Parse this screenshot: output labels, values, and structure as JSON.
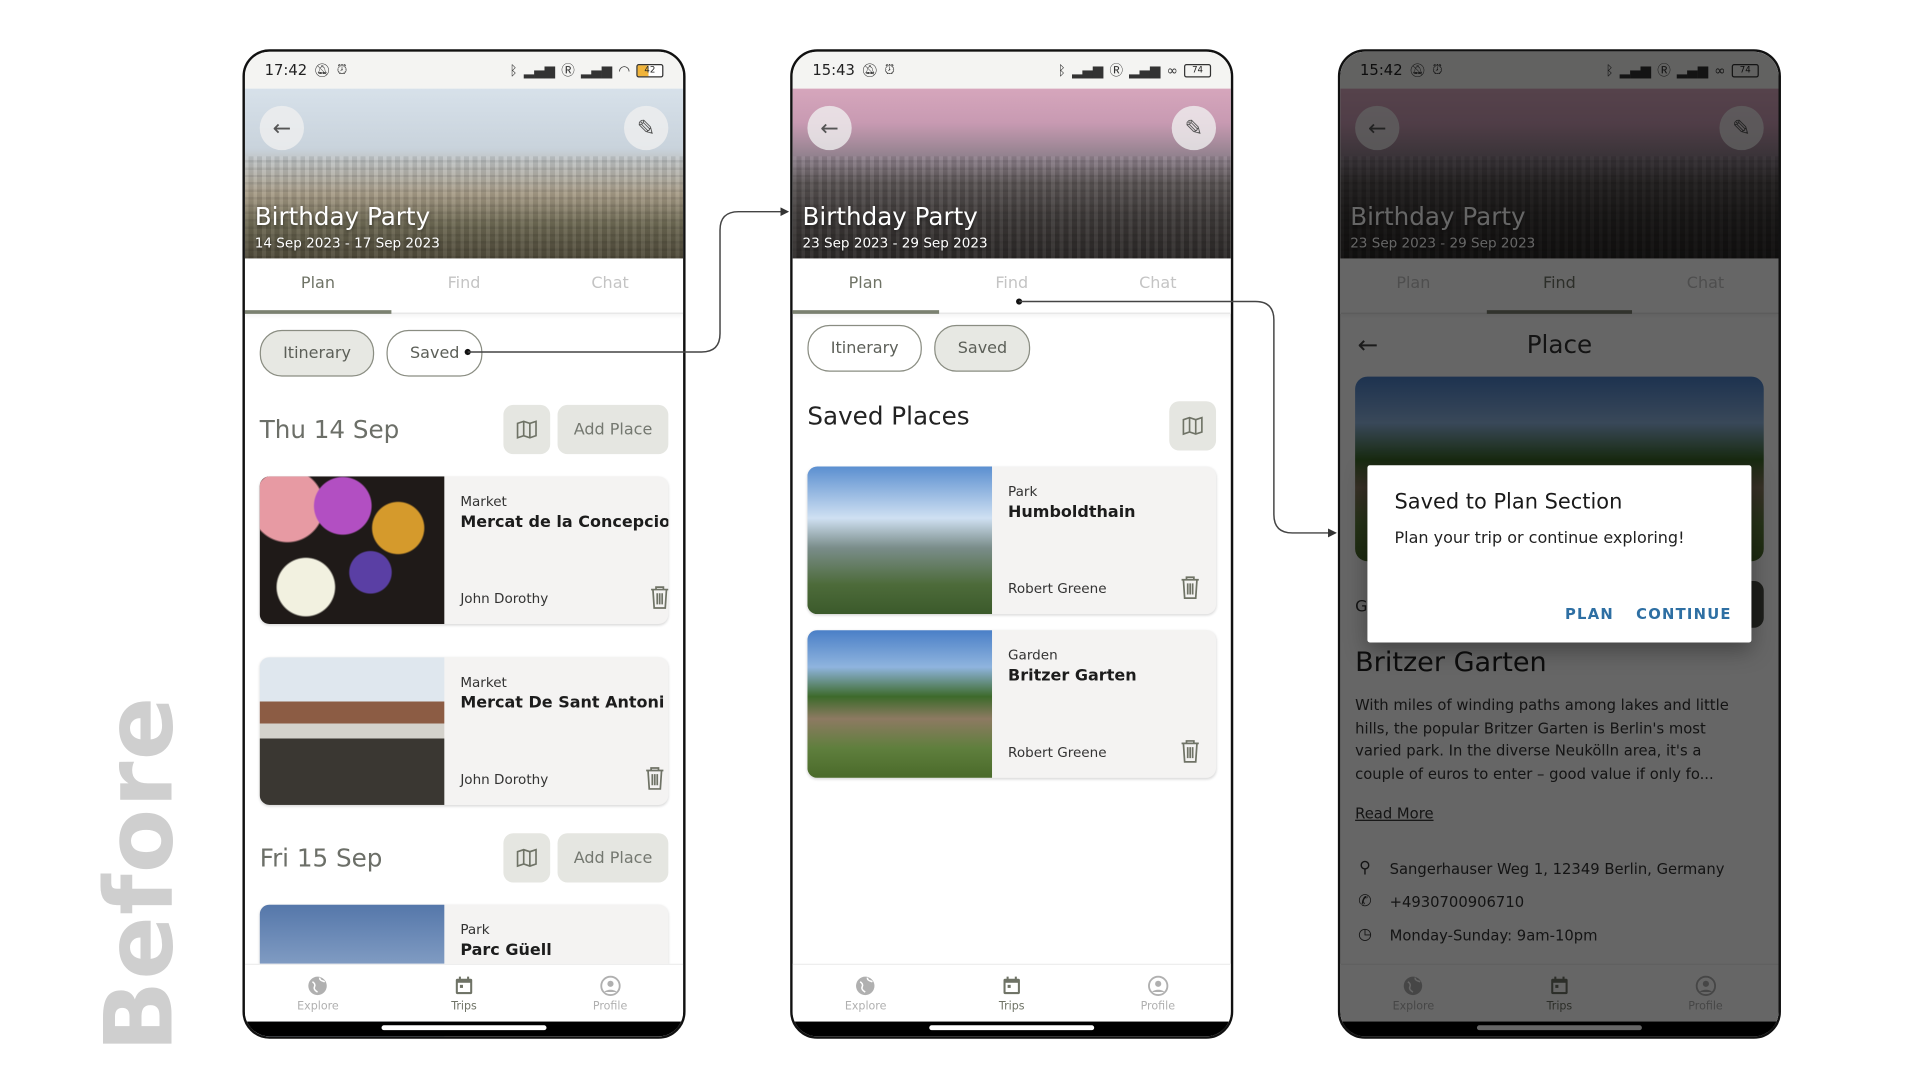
{
  "label": "Before",
  "screens": [
    {
      "status": {
        "time": "17:42",
        "battery": "42"
      },
      "hero": {
        "title": "Birthday Party",
        "dates": "14 Sep 2023 - 17 Sep 2023"
      },
      "tabs": [
        "Plan",
        "Find",
        "Chat"
      ],
      "active_tab": "Plan",
      "chips": [
        "Itinerary",
        "Saved"
      ],
      "active_chip": "Itinerary",
      "days": [
        {
          "title": "Thu 14 Sep",
          "add_label": "Add Place",
          "places": [
            {
              "category": "Market",
              "name": "Mercat de la Concepcio",
              "owner": "John Dorothy"
            },
            {
              "category": "Market",
              "name": "Mercat De Sant Antoni",
              "owner": "John Dorothy"
            }
          ]
        },
        {
          "title": "Fri 15 Sep",
          "add_label": "Add Place",
          "places": [
            {
              "category": "Park",
              "name": "Parc Güell",
              "owner": ""
            }
          ]
        }
      ],
      "nav": [
        "Explore",
        "Trips",
        "Profile"
      ],
      "active_nav": "Trips"
    },
    {
      "status": {
        "time": "15:43",
        "battery": "74"
      },
      "hero": {
        "title": "Birthday Party",
        "dates": "23 Sep 2023 - 29 Sep 2023"
      },
      "tabs": [
        "Plan",
        "Find",
        "Chat"
      ],
      "active_tab": "Plan",
      "chips": [
        "Itinerary",
        "Saved"
      ],
      "active_chip": "Saved",
      "section_title": "Saved Places",
      "places": [
        {
          "category": "Park",
          "name": "Humboldthain",
          "owner": "Robert Greene"
        },
        {
          "category": "Garden",
          "name": "Britzer Garten",
          "owner": "Robert Greene"
        }
      ],
      "nav": [
        "Explore",
        "Trips",
        "Profile"
      ],
      "active_nav": "Trips"
    },
    {
      "status": {
        "time": "15:42",
        "battery": "74"
      },
      "hero": {
        "title": "Birthday Party",
        "dates": "23 Sep 2023 - 29 Sep 2023"
      },
      "tabs": [
        "Plan",
        "Find",
        "Chat"
      ],
      "active_tab": "Find",
      "header_title": "Place",
      "place": {
        "name": "Britzer Garten",
        "description": "With miles of winding paths among lakes and little hills, the popular Britzer Garten is Berlin's most varied park. In the diverse Neukölln area, it's a couple of euros to enter – good value if only fo...",
        "read_more": "Read More",
        "address": "Sangerhauser Weg 1, 12349 Berlin, Germany",
        "phone": "+4930700906710",
        "hours": "Monday-Sunday: 9am-10pm",
        "partial_button_letter": "G"
      },
      "dialog": {
        "title": "Saved to Plan Section",
        "message": "Plan your trip or continue exploring!",
        "plan_label": "PLAN",
        "continue_label": "CONTINUE"
      },
      "nav": [
        "Explore",
        "Trips",
        "Profile"
      ],
      "active_nav": "Trips"
    }
  ],
  "colors": {
    "accent": "#7b8170",
    "dialog_action": "#2e6fa3",
    "chip_active": "#e7e8e3",
    "overlay": "rgba(0,0,0,0.6)"
  }
}
